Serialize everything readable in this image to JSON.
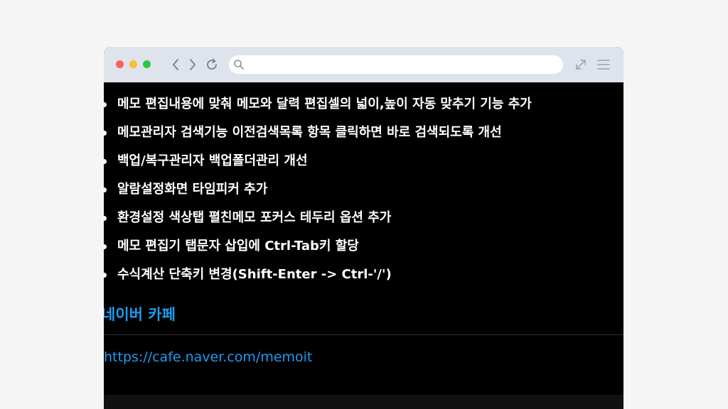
{
  "browser": {
    "url_value": "",
    "icons": {
      "back": "chevron-left-icon",
      "forward": "chevron-right-icon",
      "reload": "reload-icon",
      "search": "search-icon",
      "expand": "expand-icon",
      "menu": "hamburger-menu-icon"
    },
    "colors": {
      "toolbar": "#dfe3ec",
      "close": "#fd5f57",
      "minimize": "#febc2e",
      "maximize": "#28c840"
    }
  },
  "changelog": {
    "items": [
      "메모 편집내용에 맞춰 메모와 달력 편집셀의 넓이,높이 자동 맞추기 기능 추가",
      "메모관리자 검색기능 이전검색목록 항목 클릭하면 바로 검색되도록 개선",
      "백업/복구관리자 백업폴더관리 개선",
      "알람설정화면 타임피커 추가",
      "환경설정 색상탭 펼친메모 포커스 테두리 옵션 추가",
      "메모 편집기 탭문자 삽입에 Ctrl-Tab키 할당",
      "수식계산 단축키 변경(Shift-Enter -> Ctrl-'/')"
    ]
  },
  "cafe": {
    "title": "네이버 카페",
    "link": "https://cafe.naver.com/memoit",
    "accent_color": "#1e9bf0"
  }
}
